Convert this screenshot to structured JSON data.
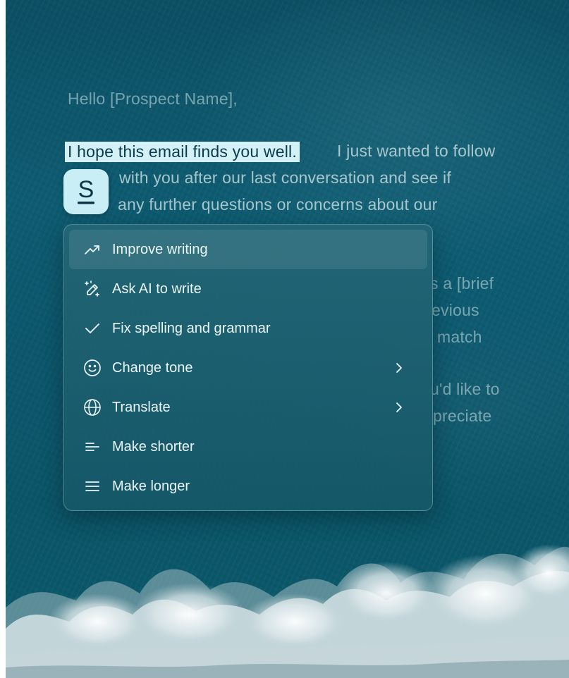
{
  "email": {
    "greeting": "Hello [Prospect Name],",
    "selected_text": "I hope this email finds you well.",
    "line1_rest": "I just wanted to follow",
    "line2": "with you after our last conversation and see if",
    "line3": "any further questions or concerns about our",
    "line5_tail": "s a [brief",
    "line6_tail": "evious",
    "line7_tail": "match",
    "line9_tail": "u'd like to",
    "line10_tail": "preciate"
  },
  "assistant": {
    "badge_letter": "S"
  },
  "menu": {
    "items": [
      {
        "label": "Improve writing",
        "icon": "trend-up-icon",
        "active": true
      },
      {
        "label": "Ask AI to write",
        "icon": "magic-pen-icon"
      },
      {
        "label": "Fix spelling and grammar",
        "icon": "check-icon"
      },
      {
        "label": "Change tone",
        "icon": "smiley-icon",
        "submenu": true
      },
      {
        "label": "Translate",
        "icon": "globe-icon",
        "submenu": true
      },
      {
        "label": "Make shorter",
        "icon": "short-lines-icon"
      },
      {
        "label": "Make longer",
        "icon": "long-lines-icon"
      }
    ]
  },
  "colors": {
    "accent": "#d4f1f7",
    "menu_bg": "#1f6476",
    "text_on_menu": "#eaf6f8"
  }
}
